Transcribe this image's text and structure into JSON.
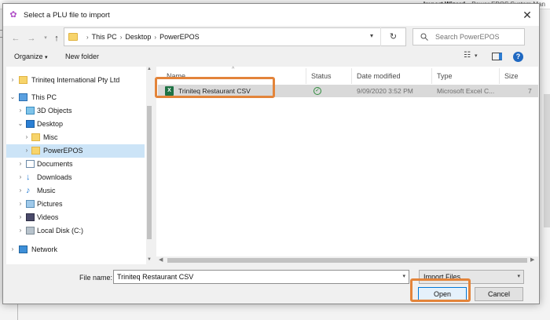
{
  "background": {
    "title_right": "Import Wizard",
    "title_far": "Power EPOS System Man"
  },
  "dialog": {
    "title": "Select a PLU file to import",
    "close_glyph": "✕"
  },
  "address": {
    "crumbs": [
      "This PC",
      "Desktop",
      "PowerEPOS"
    ],
    "search_placeholder": "Search PowerEPOS"
  },
  "toolbar": {
    "organize": "Organize",
    "new_folder": "New folder"
  },
  "navpane": {
    "items": [
      {
        "label": "Triniteq International Pty Ltd",
        "icon": "user-folder-icon"
      },
      {
        "label": "This PC",
        "icon": "computer-icon"
      },
      {
        "label": "3D Objects",
        "icon": "3d-objects-icon"
      },
      {
        "label": "Desktop",
        "icon": "desktop-icon"
      },
      {
        "label": "Misc",
        "icon": "folder-icon"
      },
      {
        "label": "PowerEPOS",
        "icon": "folder-icon"
      },
      {
        "label": "Documents",
        "icon": "documents-icon"
      },
      {
        "label": "Downloads",
        "icon": "downloads-icon"
      },
      {
        "label": "Music",
        "icon": "music-icon"
      },
      {
        "label": "Pictures",
        "icon": "pictures-icon"
      },
      {
        "label": "Videos",
        "icon": "videos-icon"
      },
      {
        "label": "Local Disk (C:)",
        "icon": "disk-icon"
      },
      {
        "label": "Network",
        "icon": "network-icon"
      }
    ]
  },
  "filelist": {
    "columns": {
      "name": "Name",
      "status": "Status",
      "date": "Date modified",
      "type": "Type",
      "size": "Size"
    },
    "rows": [
      {
        "name": "Triniteq Restaurant CSV",
        "date": "9/09/2020 3:52 PM",
        "type": "Microsoft Excel C...",
        "size": "7"
      }
    ]
  },
  "bottom": {
    "filename_label": "File name:",
    "filename_value": "Triniteq Restaurant CSV",
    "filetype_value": "Import Files",
    "open_label": "Open",
    "cancel_label": "Cancel"
  },
  "colors": {
    "highlight": "#e3843a",
    "selection": "#cce4f7",
    "excel": "#1f7244",
    "status_ok": "#2e8b3c"
  }
}
